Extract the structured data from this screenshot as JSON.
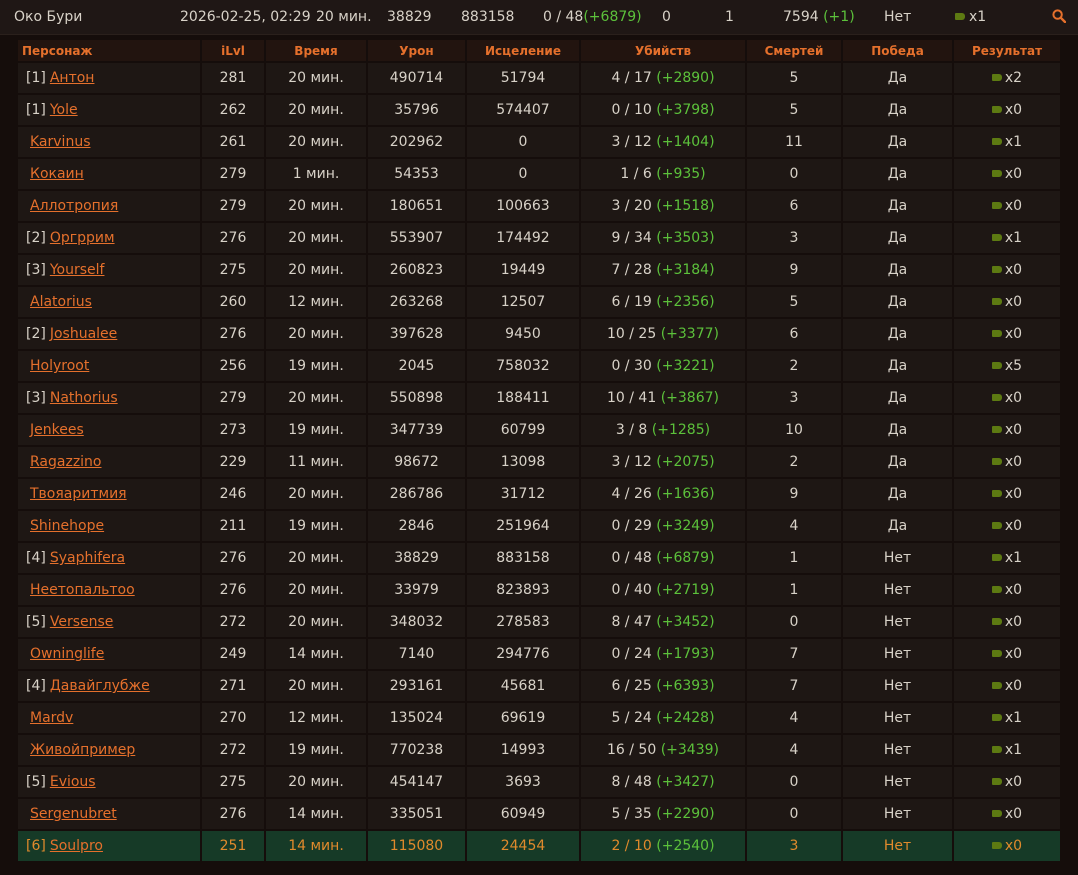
{
  "summary": {
    "map": "Око Бури",
    "date": "2026-02-25, 02:29",
    "duration": "20 мин.",
    "damage": "38829",
    "healing": "883158",
    "kills": "0 / 48",
    "kills_bonus": "(+6879)",
    "stat_a": "0",
    "stat_b": "1",
    "rating": "7594",
    "rating_change": "(+1)",
    "victory": "Нет",
    "result": "x1"
  },
  "headers": [
    "Персонаж",
    "iLvl",
    "Время",
    "Урон",
    "Исцеление",
    "Убийств",
    "Смертей",
    "Победа",
    "Результат"
  ],
  "rows": [
    {
      "group": "[1]",
      "name": "Антон",
      "ilvl": "281",
      "time": "20 мин.",
      "damage": "490714",
      "healing": "51794",
      "kills": "4 / 17",
      "bonus": "(+2890)",
      "deaths": "5",
      "win": "Да",
      "result": "x2"
    },
    {
      "group": "[1]",
      "name": "Yole",
      "ilvl": "262",
      "time": "20 мин.",
      "damage": "35796",
      "healing": "574407",
      "kills": "0 / 10",
      "bonus": "(+3798)",
      "deaths": "5",
      "win": "Да",
      "result": "x0"
    },
    {
      "group": "",
      "name": "Karvinus",
      "ilvl": "261",
      "time": "20 мин.",
      "damage": "202962",
      "healing": "0",
      "kills": "3 / 12",
      "bonus": "(+1404)",
      "deaths": "11",
      "win": "Да",
      "result": "x1"
    },
    {
      "group": "",
      "name": "Кокаин",
      "ilvl": "279",
      "time": "1 мин.",
      "damage": "54353",
      "healing": "0",
      "kills": "1 / 6",
      "bonus": "(+935)",
      "deaths": "0",
      "win": "Да",
      "result": "x0"
    },
    {
      "group": "",
      "name": "Аллотропия",
      "ilvl": "279",
      "time": "20 мин.",
      "damage": "180651",
      "healing": "100663",
      "kills": "3 / 20",
      "bonus": "(+1518)",
      "deaths": "6",
      "win": "Да",
      "result": "x0"
    },
    {
      "group": "[2]",
      "name": "Оргррим",
      "ilvl": "276",
      "time": "20 мин.",
      "damage": "553907",
      "healing": "174492",
      "kills": "9 / 34",
      "bonus": "(+3503)",
      "deaths": "3",
      "win": "Да",
      "result": "x1"
    },
    {
      "group": "[3]",
      "name": "Yourself",
      "ilvl": "275",
      "time": "20 мин.",
      "damage": "260823",
      "healing": "19449",
      "kills": "7 / 28",
      "bonus": "(+3184)",
      "deaths": "9",
      "win": "Да",
      "result": "x0"
    },
    {
      "group": "",
      "name": "Alatorius",
      "ilvl": "260",
      "time": "12 мин.",
      "damage": "263268",
      "healing": "12507",
      "kills": "6 / 19",
      "bonus": "(+2356)",
      "deaths": "5",
      "win": "Да",
      "result": "x0"
    },
    {
      "group": "[2]",
      "name": "Joshualee",
      "ilvl": "276",
      "time": "20 мин.",
      "damage": "397628",
      "healing": "9450",
      "kills": "10 / 25",
      "bonus": "(+3377)",
      "deaths": "6",
      "win": "Да",
      "result": "x0"
    },
    {
      "group": "",
      "name": "Holyroot",
      "ilvl": "256",
      "time": "19 мин.",
      "damage": "2045",
      "healing": "758032",
      "kills": "0 / 30",
      "bonus": "(+3221)",
      "deaths": "2",
      "win": "Да",
      "result": "x5"
    },
    {
      "group": "[3]",
      "name": "Nathorius",
      "ilvl": "279",
      "time": "20 мин.",
      "damage": "550898",
      "healing": "188411",
      "kills": "10 / 41",
      "bonus": "(+3867)",
      "deaths": "3",
      "win": "Да",
      "result": "x0"
    },
    {
      "group": "",
      "name": "Jenkees",
      "ilvl": "273",
      "time": "19 мин.",
      "damage": "347739",
      "healing": "60799",
      "kills": "3 / 8",
      "bonus": "(+1285)",
      "deaths": "10",
      "win": "Да",
      "result": "x0"
    },
    {
      "group": "",
      "name": "Ragazzino",
      "ilvl": "229",
      "time": "11 мин.",
      "damage": "98672",
      "healing": "13098",
      "kills": "3 / 12",
      "bonus": "(+2075)",
      "deaths": "2",
      "win": "Да",
      "result": "x0"
    },
    {
      "group": "",
      "name": "Твояаритмия",
      "ilvl": "246",
      "time": "20 мин.",
      "damage": "286786",
      "healing": "31712",
      "kills": "4 / 26",
      "bonus": "(+1636)",
      "deaths": "9",
      "win": "Да",
      "result": "x0"
    },
    {
      "group": "",
      "name": "Shinehope",
      "ilvl": "211",
      "time": "19 мин.",
      "damage": "2846",
      "healing": "251964",
      "kills": "0 / 29",
      "bonus": "(+3249)",
      "deaths": "4",
      "win": "Да",
      "result": "x0"
    },
    {
      "group": "[4]",
      "name": "Syaphifera",
      "ilvl": "276",
      "time": "20 мин.",
      "damage": "38829",
      "healing": "883158",
      "kills": "0 / 48",
      "bonus": "(+6879)",
      "deaths": "1",
      "win": "Нет",
      "result": "x1"
    },
    {
      "group": "",
      "name": "Неетопальтоо",
      "ilvl": "276",
      "time": "20 мин.",
      "damage": "33979",
      "healing": "823893",
      "kills": "0 / 40",
      "bonus": "(+2719)",
      "deaths": "1",
      "win": "Нет",
      "result": "x0"
    },
    {
      "group": "[5]",
      "name": "Versense",
      "ilvl": "272",
      "time": "20 мин.",
      "damage": "348032",
      "healing": "278583",
      "kills": "8 / 47",
      "bonus": "(+3452)",
      "deaths": "0",
      "win": "Нет",
      "result": "x0"
    },
    {
      "group": "",
      "name": "Owninglife",
      "ilvl": "249",
      "time": "14 мин.",
      "damage": "7140",
      "healing": "294776",
      "kills": "0 / 24",
      "bonus": "(+1793)",
      "deaths": "7",
      "win": "Нет",
      "result": "x0"
    },
    {
      "group": "[4]",
      "name": "Давайглубже",
      "ilvl": "271",
      "time": "20 мин.",
      "damage": "293161",
      "healing": "45681",
      "kills": "6 / 25",
      "bonus": "(+6393)",
      "deaths": "7",
      "win": "Нет",
      "result": "x0"
    },
    {
      "group": "",
      "name": "Mardv",
      "ilvl": "270",
      "time": "12 мин.",
      "damage": "135024",
      "healing": "69619",
      "kills": "5 / 24",
      "bonus": "(+2428)",
      "deaths": "4",
      "win": "Нет",
      "result": "x1"
    },
    {
      "group": "",
      "name": "Живойпример",
      "ilvl": "272",
      "time": "19 мин.",
      "damage": "770238",
      "healing": "14993",
      "kills": "16 / 50",
      "bonus": "(+3439)",
      "deaths": "4",
      "win": "Нет",
      "result": "x1"
    },
    {
      "group": "[5]",
      "name": "Evious",
      "ilvl": "275",
      "time": "20 мин.",
      "damage": "454147",
      "healing": "3693",
      "kills": "8 / 48",
      "bonus": "(+3427)",
      "deaths": "0",
      "win": "Нет",
      "result": "x0"
    },
    {
      "group": "",
      "name": "Sergenubret",
      "ilvl": "276",
      "time": "14 мин.",
      "damage": "335051",
      "healing": "60949",
      "kills": "5 / 35",
      "bonus": "(+2290)",
      "deaths": "0",
      "win": "Нет",
      "result": "x0"
    },
    {
      "group": "[6]",
      "name": "Soulpro",
      "ilvl": "251",
      "time": "14 мин.",
      "damage": "115080",
      "healing": "24454",
      "kills": "2 / 10",
      "bonus": "(+2540)",
      "deaths": "3",
      "win": "Нет",
      "result": "x0",
      "highlighted": true
    }
  ]
}
